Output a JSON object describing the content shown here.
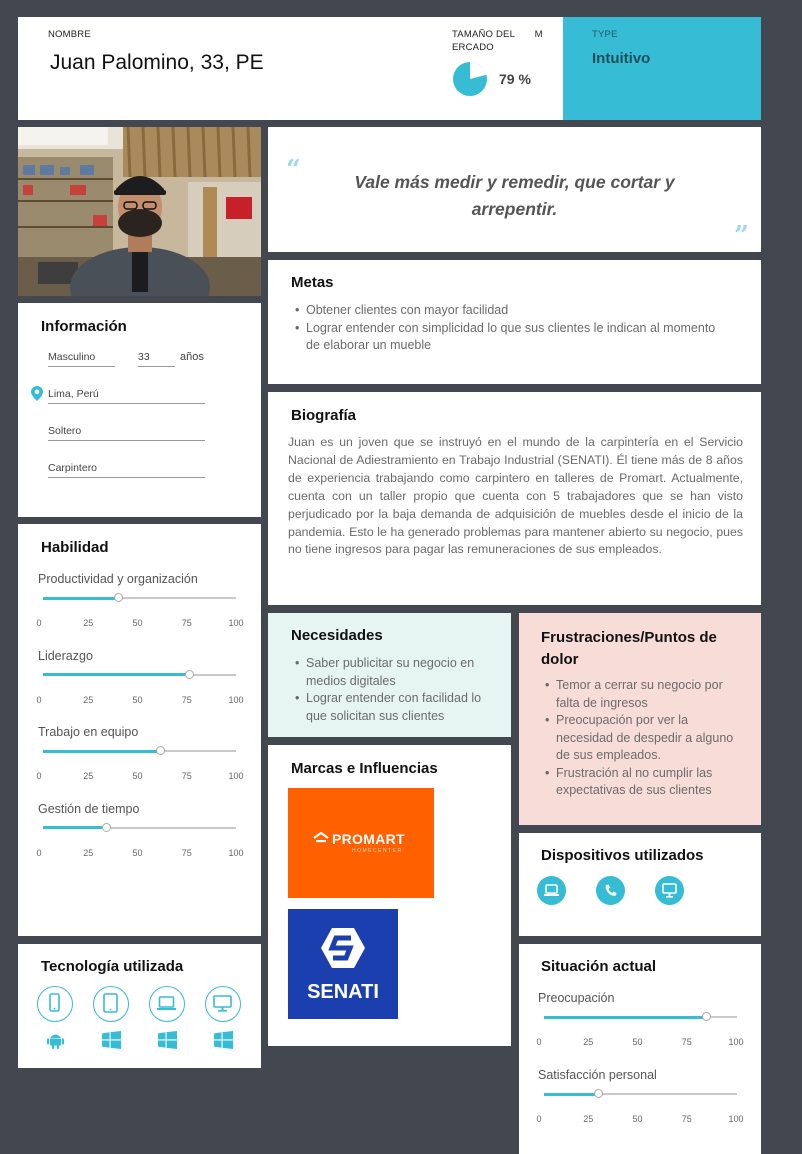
{
  "header": {
    "name_label": "NOMBRE",
    "name": "Juan Palomino, 33, PE",
    "market_label": "TAMAÑO DEL       M\nERCADO",
    "market_value": "79 %",
    "market_fraction": 0.79,
    "type_label": "TYPE",
    "type_value": "Intuitivo"
  },
  "quote": {
    "open_mark": "“",
    "text": "Vale más medir y remedir, que cortar y arrepentir.",
    "close_mark": "”"
  },
  "info": {
    "title": "Información",
    "gender": "Masculino",
    "age": "33",
    "age_unit": "años",
    "location": "Lima, Perú",
    "status": "Soltero",
    "occupation": "Carpintero"
  },
  "goals": {
    "title": "Metas",
    "items": [
      "Obtener clientes con mayor facilidad",
      "Lograr entender con simplicidad lo que sus clientes le indican al momento de elaborar un mueble"
    ]
  },
  "bio": {
    "title": "Biografía",
    "text": "Juan es un joven que se instruyó en el mundo de la carpintería en el Servicio Nacional de Adiestramiento en Trabajo Industrial (SENATI). Él tiene más de 8 años de experiencia trabajando como carpintero en talleres de Promart. Actualmente, cuenta con un taller propio que cuenta con 5 trabajadores que se han visto perjudicado por la baja demanda de adquisición de muebles desde el inicio de la pandemia. Esto le ha generado problemas para mantener abierto su negocio, pues no tiene ingresos para pagar las remuneraciones de sus empleados."
  },
  "skills": {
    "title": "Habilidad",
    "ticks": [
      "0",
      "25",
      "50",
      "75",
      "100"
    ],
    "items": [
      {
        "label": "Productividad y organización",
        "value": 39
      },
      {
        "label": "Liderazgo",
        "value": 76
      },
      {
        "label": "Trabajo en equipo",
        "value": 61
      },
      {
        "label": "Gestión de tiempo",
        "value": 33
      }
    ]
  },
  "needs": {
    "title": "Necesidades",
    "items": [
      "Saber publicitar su negocio en medios digitales",
      "Lograr entender con facilidad lo que solicitan sus clientes"
    ]
  },
  "frustrations": {
    "title": "Frustraciones/Puntos de dolor",
    "items": [
      "Temor a cerrar su negocio por falta de ingresos",
      "Preocupación por ver la necesidad de despedir a alguno de sus empleados.",
      "Frustración al no cumplir las expectativas de sus clientes"
    ]
  },
  "brands": {
    "title": "Marcas e Influencias",
    "promart": {
      "name": "PROMART",
      "sub": "HOMECENTER",
      "color": "#ff6000"
    },
    "senati": {
      "name": "SENATI",
      "color": "#1b3fae"
    }
  },
  "devices": {
    "title": "Dispositivos utilizados",
    "icons": [
      "laptop-icon",
      "phone-icon",
      "desktop-icon"
    ]
  },
  "tech": {
    "title": "Tecnología utilizada",
    "devices": [
      "smartphone-icon",
      "tablet-icon",
      "laptop-icon",
      "desktop-icon"
    ],
    "os": [
      "android-icon",
      "windows-icon",
      "windows-icon",
      "windows-icon"
    ]
  },
  "situation": {
    "title": "Situación actual",
    "ticks": [
      "0",
      "25",
      "50",
      "75",
      "100"
    ],
    "items": [
      {
        "label": "Preocupación",
        "value": 84
      },
      {
        "label": "Satisfacción personal",
        "value": 28
      }
    ]
  },
  "colors": {
    "accent": "#36bcd4",
    "background": "#434750",
    "needs_bg": "#e6f5f2",
    "frustrations_bg": "#f8dcd8"
  }
}
